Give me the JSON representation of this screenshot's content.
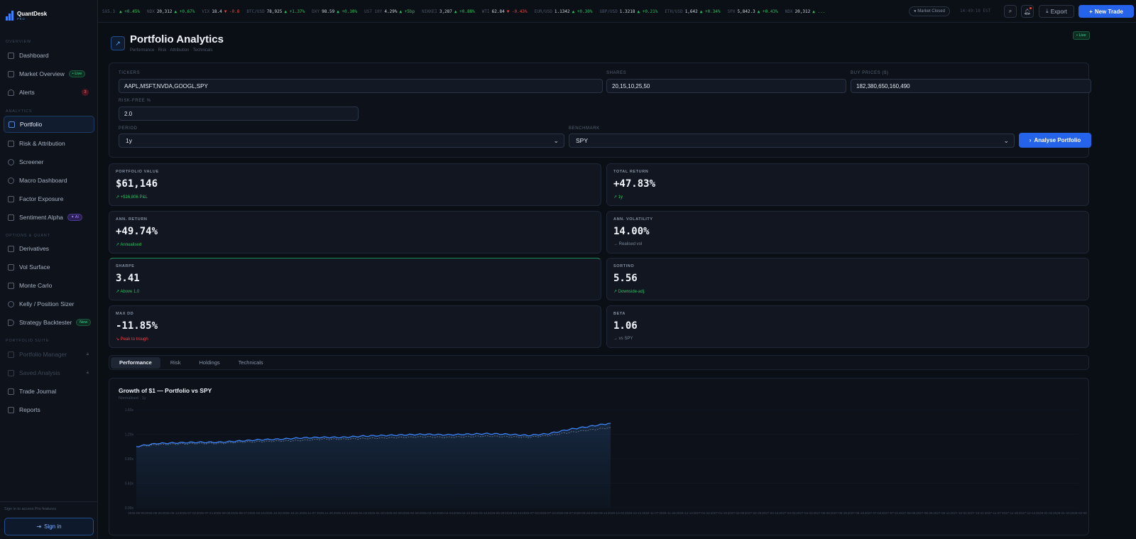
{
  "brand": {
    "name": "QuantDesk",
    "sub": "PRO"
  },
  "sidebar": {
    "sections": [
      "OVERVIEW",
      "ANALYTICS",
      "OPTIONS & QUANT",
      "PORTFOLIO SUITE"
    ],
    "items": [
      {
        "label": "Dashboard"
      },
      {
        "label": "Market Overview",
        "badge": "• Live"
      },
      {
        "label": "Alerts",
        "badge": "3"
      },
      {
        "label": "Portfolio",
        "active": true
      },
      {
        "label": "Risk & Attribution"
      },
      {
        "label": "Screener"
      },
      {
        "label": "Macro Dashboard"
      },
      {
        "label": "Factor Exposure"
      },
      {
        "label": "Sentiment Alpha",
        "badge": "✦ AI"
      },
      {
        "label": "Derivatives"
      },
      {
        "label": "Vol Surface"
      },
      {
        "label": "Monte Carlo"
      },
      {
        "label": "Kelly / Position Sizer"
      },
      {
        "label": "Strategy Backtester",
        "badge": "New"
      },
      {
        "label": "Portfolio Manager",
        "locked": true
      },
      {
        "label": "Saved Analysis",
        "locked": true
      },
      {
        "label": "Trade Journal"
      },
      {
        "label": "Reports"
      }
    ],
    "signin_hint": "Sign in to access Pro features",
    "signin_label": "Sign in"
  },
  "ticker": [
    {
      "sym": "SX5.3",
      "price": "",
      "chg": "▲ +0.45%",
      "dir": "up"
    },
    {
      "sym": "NDX",
      "price": "20,312",
      "chg": "▲ +0.67%",
      "dir": "up"
    },
    {
      "sym": "VIX",
      "price": "18.4",
      "chg": "▼ -0.8",
      "dir": "dn"
    },
    {
      "sym": "BTC/USD",
      "price": "78,925",
      "chg": "▲ +1.37%",
      "dir": "up"
    },
    {
      "sym": "DXY",
      "price": "98.59",
      "chg": "▲ +0.10%",
      "dir": "up"
    },
    {
      "sym": "US7 10Y",
      "price": "4.29%",
      "chg": "▲ +5bp",
      "dir": "up"
    },
    {
      "sym": "NIKKEI",
      "price": "3,287",
      "chg": "▲ +0.88%",
      "dir": "up"
    },
    {
      "sym": "WTI",
      "price": "62.84",
      "chg": "▼ -0.43%",
      "dir": "dn"
    },
    {
      "sym": "EUR/USD",
      "price": "1.1342",
      "chg": "▲ +0.30%",
      "dir": "up"
    },
    {
      "sym": "GBP/USD",
      "price": "1.3218",
      "chg": "▲ +0.21%",
      "dir": "up"
    },
    {
      "sym": "ETH/USD",
      "price": "1,642",
      "chg": "▲ +0.34%",
      "dir": "up"
    },
    {
      "sym": "SPX",
      "price": "5,842.3",
      "chg": "▲ +0.43%",
      "dir": "up"
    },
    {
      "sym": "NDX",
      "price": "20,312",
      "chg": "▲ ...",
      "dir": "up"
    }
  ],
  "topbar": {
    "market_status": "● Market Closed",
    "clock": "14:49:18 EST",
    "export_label": "Export",
    "new_trade_label": "New Trade"
  },
  "page": {
    "title": "Portfolio Analytics",
    "subtitle": "Performance · Risk · Attribution · Technicals",
    "live": "• Live"
  },
  "form": {
    "tickers_label": "TICKERS",
    "tickers_value": "AAPL,MSFT,NVDA,GOOGL,SPY",
    "shares_label": "SHARES",
    "shares_value": "20,15,10,25,50",
    "buy_label": "BUY PRICES ($)",
    "buy_value": "182,380,650,160,490",
    "rf_label": "RISK-FREE %",
    "rf_value": "2.0",
    "period_label": "PERIOD",
    "period_value": "1y",
    "bench_label": "BENCHMARK",
    "bench_value": "SPY",
    "analyse_label": "Analyse Portfolio"
  },
  "metrics": [
    {
      "label": "PORTFOLIO VALUE",
      "value": "$61,146",
      "sub": "↗ +$16,806 P&L",
      "tone": "pos"
    },
    {
      "label": "TOTAL RETURN",
      "value": "+47.83%",
      "sub": "↗ 1y",
      "tone": "pos"
    },
    {
      "label": "ANN. RETURN",
      "value": "+49.74%",
      "sub": "↗ Annualised",
      "tone": "pos"
    },
    {
      "label": "ANN. VOLATILITY",
      "value": "14.00%",
      "sub": "→ Realised vol",
      "tone": "neu"
    },
    {
      "label": "SHARPE",
      "value": "3.41",
      "sub": "↗ Above 1.0",
      "tone": "pos"
    },
    {
      "label": "SORTINO",
      "value": "5.56",
      "sub": "↗ Downside-adj.",
      "tone": "pos"
    },
    {
      "label": "MAX DD",
      "value": "-11.85%",
      "sub": "↘ Peak to trough",
      "tone": "neg"
    },
    {
      "label": "BETA",
      "value": "1.06",
      "sub": "→ vs SPY",
      "tone": "neu"
    }
  ],
  "tabs": [
    "Performance",
    "Risk",
    "Holdings",
    "Technicals"
  ],
  "chart_data": {
    "type": "line",
    "title": "Growth of $1 — Portfolio vs SPY",
    "subtitle": "Normalised · 1y",
    "ylim": [
      0.0,
      1.6
    ],
    "yticks": [
      "1.60x",
      "1.20x",
      "0.80x",
      "0.40x",
      "0.00x"
    ],
    "xticks": [
      "2025-05-06",
      "2025-05-26",
      "2025-06-13",
      "2025-07-02",
      "2025-07-21",
      "2025-08-08",
      "2025-08-27",
      "2025-09-15",
      "2025-10-02",
      "2025-10-21",
      "2025-11-07",
      "2025-11-26",
      "2025-12-14",
      "2026-01-02",
      "2026-01-20",
      "2026-02-08",
      "2026-02-26",
      "2026-03-16",
      "2026-04-04",
      "2026-04-22",
      "2026-05-12",
      "2026-05-29",
      "2026-06-16",
      "2026-07-03",
      "2026-07-22",
      "2026-08-07",
      "2026-08-26",
      "2026-09-14",
      "2026-10-02",
      "2026-10-21",
      "2026-11-07",
      "2026-11-26",
      "2026-12-14",
      "2027-01-02",
      "2027-01-20",
      "2027-02-08",
      "2027-02-26",
      "2027-03-16",
      "2027-04-03",
      "2027-04-22",
      "2027-05-09",
      "2027-05-29",
      "2027-06-16",
      "2027-07-03",
      "2027-07-21",
      "2027-08-08",
      "2027-08-26",
      "2027-09-14",
      "2027-10-02",
      "2027-10-21",
      "2027-11-07",
      "2027-11-26",
      "2027-12-14",
      "2028-01-02",
      "2028-01-20",
      "2028-02-08"
    ],
    "series": [
      {
        "name": "Portfolio",
        "color": "#3b82f6",
        "values": [
          1.0,
          1.05,
          1.06,
          1.07,
          1.07,
          1.09,
          1.11,
          1.12,
          1.14,
          1.15,
          1.15,
          1.17,
          1.18,
          1.19,
          1.2,
          1.19,
          1.2,
          1.21,
          1.2,
          1.18,
          1.21,
          1.28,
          1.33,
          1.38
        ]
      },
      {
        "name": "SPY",
        "color": "#64748b",
        "values": [
          1.0,
          1.03,
          1.04,
          1.05,
          1.05,
          1.07,
          1.08,
          1.09,
          1.1,
          1.12,
          1.12,
          1.13,
          1.14,
          1.15,
          1.16,
          1.15,
          1.16,
          1.17,
          1.16,
          1.15,
          1.18,
          1.23,
          1.27,
          1.31
        ]
      }
    ]
  }
}
